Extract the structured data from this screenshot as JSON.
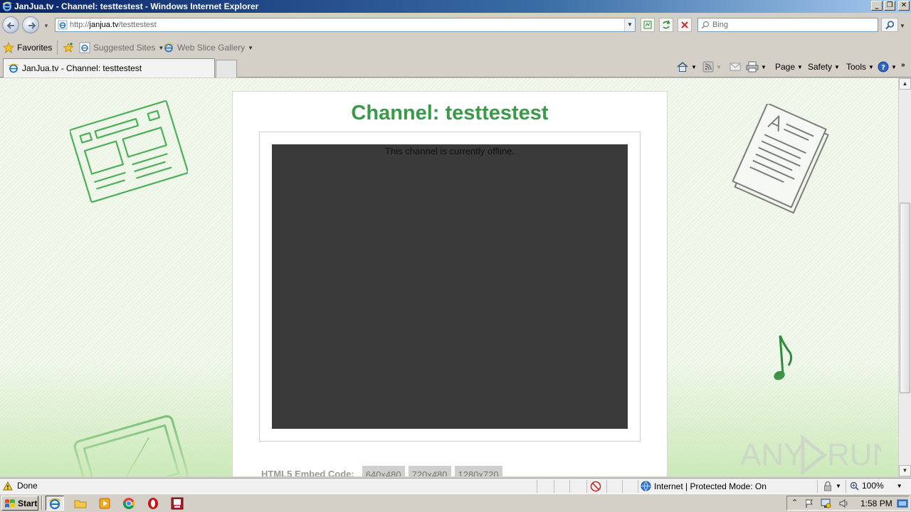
{
  "window": {
    "title": "JanJua.tv - Channel: testtestest - Windows Internet Explorer"
  },
  "address_bar": {
    "url_prefix": "http://",
    "url_host": "janjua.tv",
    "url_path": "/testtestest"
  },
  "search": {
    "placeholder": "Bing"
  },
  "favorites_bar": {
    "favorites_label": "Favorites",
    "suggested_sites_label": "Suggested Sites",
    "web_slice_gallery_label": "Web Slice Gallery"
  },
  "tab": {
    "label": "JanJua.tv - Channel: testtestest"
  },
  "command_bar": {
    "page_label": "Page",
    "safety_label": "Safety",
    "tools_label": "Tools"
  },
  "page": {
    "channel_title": "Channel: testtestest",
    "offline_message": "This channel is currently offline.",
    "embed_label": "HTML5 Embed Code:",
    "embed_sizes": [
      "640x480",
      "720x480",
      "1280x720"
    ]
  },
  "watermark": {
    "text": "ANY RUN"
  },
  "status_bar": {
    "status_text": "Done",
    "zone_text": "Internet | Protected Mode: On",
    "zoom_text": "100%"
  },
  "taskbar": {
    "start_label": "Start",
    "clock": "1:58 PM"
  },
  "colors": {
    "title_green": "#3a9a48",
    "player_bg": "#3a3a3a",
    "page_bg": "#eaf4e2"
  }
}
